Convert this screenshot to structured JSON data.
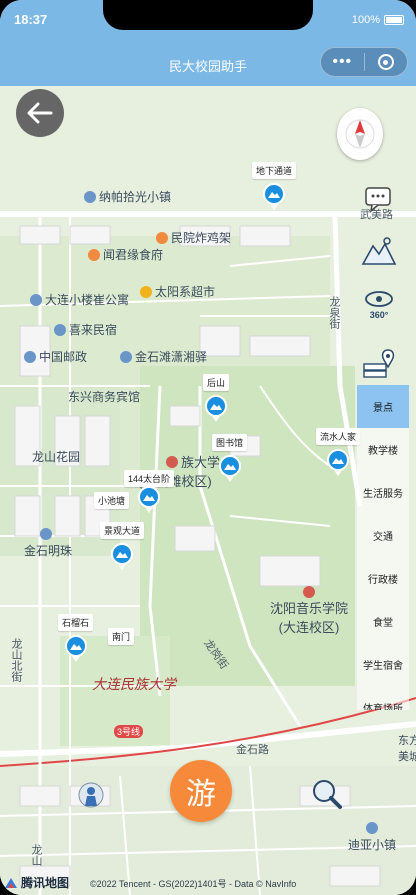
{
  "status": {
    "time": "18:37",
    "battery": "100%"
  },
  "header": {
    "title": "民大校园助手",
    "menu_dots": "•••"
  },
  "map": {
    "pois": {
      "nabo": "纳帕拾光小镇",
      "wenjing": "闻君缘食府",
      "minyuan": "民院炸鸡架",
      "taiyang": "太阳系超市",
      "dalian": "大连小楼崔公寓",
      "xilai": "喜来民宿",
      "youzheng": "中国邮政",
      "jinshi_tan": "金石滩潇湘驿",
      "dongxing": "东兴商务宾馆",
      "longshan": "龙山花园",
      "minda": "族大学",
      "minda2": "(金石滩校区)",
      "jinshi_mingzhu": "金石明珠",
      "yinyue": "沈阳音乐学院",
      "yinyue2": "(大连校区)",
      "diya": "迪亚小镇",
      "dongfang": "东方",
      "meihu": "美城"
    },
    "roads": {
      "wumei": "武美路",
      "longquan": "龙泉街",
      "jinshi": "金石路",
      "longshan_north": "龙山北街",
      "longgang": "龙岗街",
      "metro": "3号线",
      "longshan_left": "龙山"
    },
    "markers": [
      {
        "label": "地下通道"
      },
      {
        "label": "后山"
      },
      {
        "label": "图书馆"
      },
      {
        "label": "流水人家"
      },
      {
        "label": "144太台阶"
      },
      {
        "label": "小池塘"
      },
      {
        "label": "景观大道"
      },
      {
        "label": "石榴石"
      },
      {
        "label": "南门"
      }
    ],
    "campus_sign": "大连民族大学",
    "logo_text": "腾讯地图",
    "copyright": "©2022 Tencent - GS(2022)1401号 - Data © NavInfo"
  },
  "tabs": [
    {
      "label": "景点",
      "active": true
    },
    {
      "label": "教学楼",
      "active": false
    },
    {
      "label": "生活服务",
      "active": false
    },
    {
      "label": "交通",
      "active": false
    },
    {
      "label": "行政楼",
      "active": false
    },
    {
      "label": "食堂",
      "active": false
    },
    {
      "label": "学生宿舍",
      "active": false
    },
    {
      "label": "体育场所",
      "active": false
    }
  ],
  "tools": {
    "tool_360_label": "360°"
  },
  "fab": {
    "label": "游"
  },
  "colors": {
    "header": "#7cb8e6",
    "accent": "#f78a3a",
    "marker": "#1a8fe0",
    "active_tab": "#8cc3f0"
  }
}
